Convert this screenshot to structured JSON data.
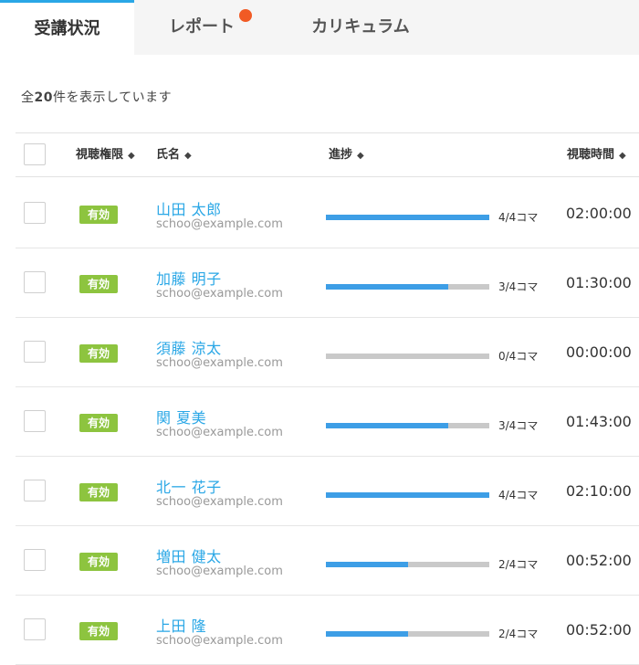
{
  "tabs": [
    {
      "label": "受講状況",
      "active": true
    },
    {
      "label": "レポート",
      "active": false,
      "notification": true
    },
    {
      "label": "カリキュラム",
      "active": false
    }
  ],
  "summary": {
    "prefix": "全",
    "count": "20",
    "suffix": "件を表示しています"
  },
  "table": {
    "headers": {
      "access": "視聴権限",
      "name": "氏名",
      "progress": "進捗",
      "time": "視聴時間"
    },
    "sort_icon": "◆",
    "rows": [
      {
        "status": "有効",
        "name": "山田 太郎",
        "email": "schoo@example.com",
        "progress_done": 4,
        "progress_total": 4,
        "progress_text": "4/4コマ",
        "time": "02:00:00"
      },
      {
        "status": "有効",
        "name": "加藤 明子",
        "email": "schoo@example.com",
        "progress_done": 3,
        "progress_total": 4,
        "progress_text": "3/4コマ",
        "time": "01:30:00"
      },
      {
        "status": "有効",
        "name": "須藤 涼太",
        "email": "schoo@example.com",
        "progress_done": 0,
        "progress_total": 4,
        "progress_text": "0/4コマ",
        "time": "00:00:00"
      },
      {
        "status": "有効",
        "name": "関 夏美",
        "email": "schoo@example.com",
        "progress_done": 3,
        "progress_total": 4,
        "progress_text": "3/4コマ",
        "time": "01:43:00"
      },
      {
        "status": "有効",
        "name": "北一 花子",
        "email": "schoo@example.com",
        "progress_done": 4,
        "progress_total": 4,
        "progress_text": "4/4コマ",
        "time": "02:10:00"
      },
      {
        "status": "有効",
        "name": "増田 健太",
        "email": "schoo@example.com",
        "progress_done": 2,
        "progress_total": 4,
        "progress_text": "2/4コマ",
        "time": "00:52:00"
      },
      {
        "status": "有効",
        "name": "上田 隆",
        "email": "schoo@example.com",
        "progress_done": 2,
        "progress_total": 4,
        "progress_text": "2/4コマ",
        "time": "00:52:00"
      }
    ]
  },
  "colors": {
    "accent": "#2aa7e6",
    "badge": "#8dc43f",
    "progress": "#3d9ee6",
    "progress_track": "#c9c9c9",
    "notification": "#f15a24"
  }
}
